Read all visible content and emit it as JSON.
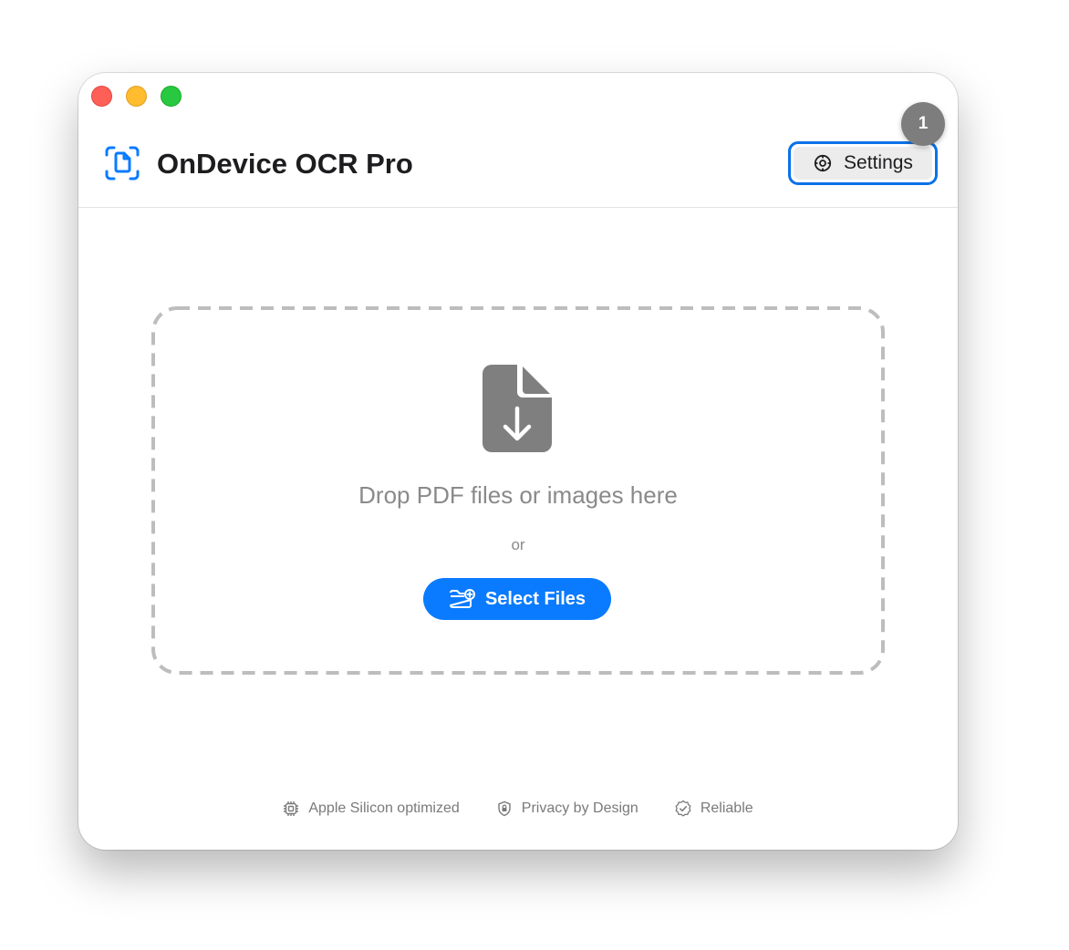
{
  "app": {
    "title": "OnDevice OCR Pro",
    "icon": "doc-viewfinder-icon"
  },
  "header": {
    "settings_label": "Settings",
    "settings_icon": "gear-icon"
  },
  "step_badge": "1",
  "dropzone": {
    "title": "Drop PDF files or images here",
    "or_label": "or",
    "select_label": "Select Files",
    "icon": "document-download-icon"
  },
  "footer": {
    "features": [
      {
        "label": "Apple Silicon optimized",
        "icon": "cpu-icon"
      },
      {
        "label": "Privacy by Design",
        "icon": "lock-shield-icon"
      },
      {
        "label": "Reliable",
        "icon": "checkmark-seal-icon"
      }
    ]
  },
  "colors": {
    "accent": "#0a7bff",
    "focus_ring": "#0a72e8",
    "muted": "#8a8a8a"
  }
}
